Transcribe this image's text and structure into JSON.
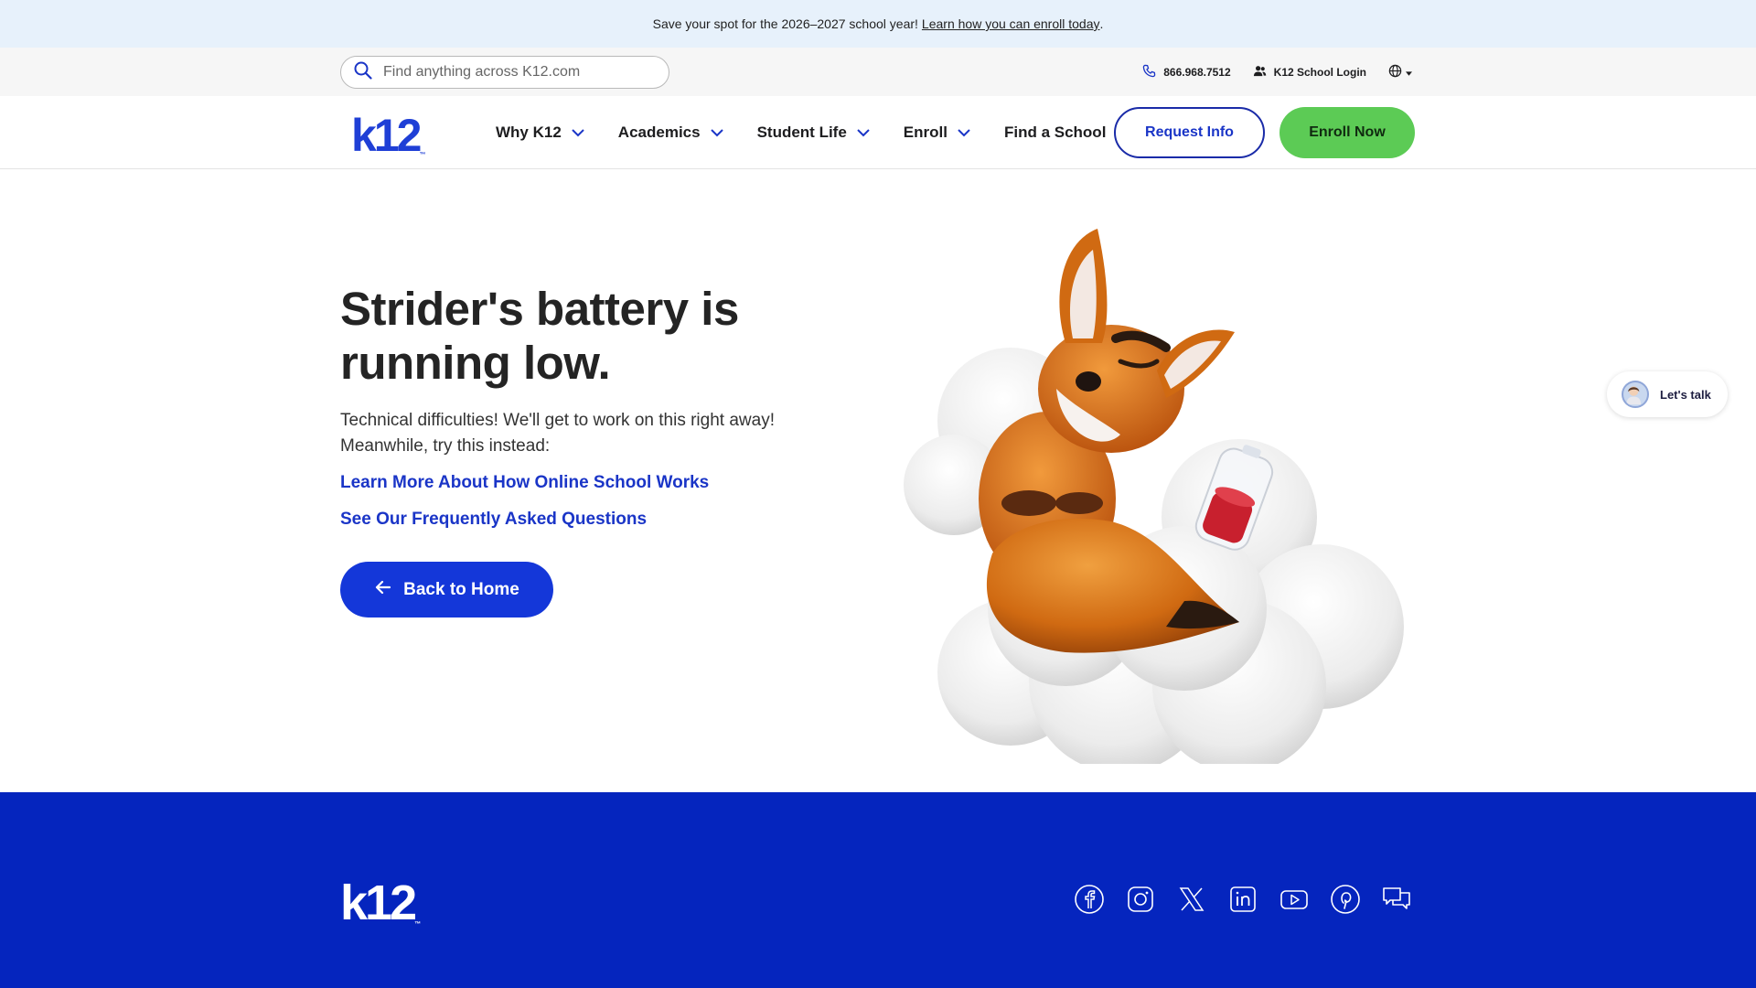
{
  "announcement": {
    "text": "Save your spot for the 2026–2027 school year!",
    "link": "Learn how you can enroll today",
    "suffix": "."
  },
  "utility": {
    "search_placeholder": "Find anything across K12.com",
    "phone": "866.968.7512",
    "login": "K12 School Login"
  },
  "nav": {
    "logo": "k12",
    "logo_tm": "™",
    "items": [
      {
        "label": "Why K12"
      },
      {
        "label": "Academics"
      },
      {
        "label": "Student Life"
      },
      {
        "label": "Enroll"
      },
      {
        "label": "Find a School"
      }
    ],
    "request_info": "Request Info",
    "enroll_now": "Enroll Now"
  },
  "hero": {
    "title": "Strider's battery is running low.",
    "description": "Technical difficulties! We'll get to work on this right away! Meanwhile, try this instead:",
    "links": [
      {
        "label": "Learn More About How Online School Works"
      },
      {
        "label": "See Our Frequently Asked Questions"
      }
    ],
    "back_button": "Back to Home"
  },
  "chat": {
    "label": "Let's talk"
  },
  "footer": {
    "logo": "k12",
    "logo_tm": "™",
    "social": [
      "facebook-icon",
      "instagram-icon",
      "x-icon",
      "linkedin-icon",
      "youtube-icon",
      "pinterest-icon",
      "chat-icon"
    ]
  },
  "colors": {
    "primary_blue": "#1437d9",
    "footer_blue": "#0525be",
    "green": "#5ccb55",
    "announce_bg": "#e7f1fb"
  }
}
